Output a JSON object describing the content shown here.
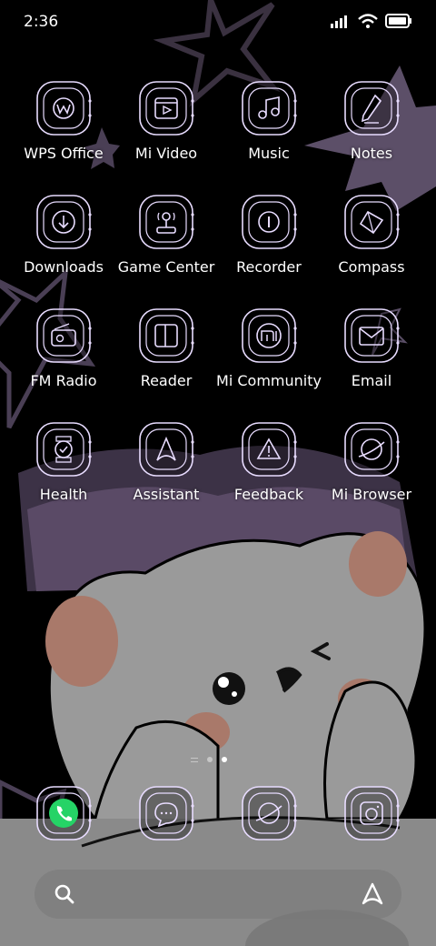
{
  "status_bar": {
    "time": "2:36",
    "icons": [
      "signal-icon",
      "wifi-icon",
      "battery-icon"
    ]
  },
  "theme": {
    "icon_stroke": "#e8dcff",
    "accent_purple": "#5a4a66",
    "bear_gray": "#9a9a9a",
    "whatsapp_green": "#25d366"
  },
  "apps": [
    {
      "label": "WPS Office",
      "icon": "wps-office-icon"
    },
    {
      "label": "Mi Video",
      "icon": "mi-video-icon"
    },
    {
      "label": "Music",
      "icon": "music-icon"
    },
    {
      "label": "Notes",
      "icon": "notes-icon"
    },
    {
      "label": "Downloads",
      "icon": "downloads-icon"
    },
    {
      "label": "Game Center",
      "icon": "game-center-icon"
    },
    {
      "label": "Recorder",
      "icon": "recorder-icon"
    },
    {
      "label": "Compass",
      "icon": "compass-icon"
    },
    {
      "label": "FM Radio",
      "icon": "fm-radio-icon"
    },
    {
      "label": "Reader",
      "icon": "reader-icon"
    },
    {
      "label": "Mi Community",
      "icon": "mi-community-icon"
    },
    {
      "label": "Email",
      "icon": "email-icon"
    },
    {
      "label": "Health",
      "icon": "health-icon"
    },
    {
      "label": "Assistant",
      "icon": "assistant-icon"
    },
    {
      "label": "Feedback",
      "icon": "feedback-icon"
    },
    {
      "label": "Mi Browser",
      "icon": "mi-browser-icon"
    }
  ],
  "page_indicator": {
    "pages": 3,
    "active_page": 3
  },
  "dock": [
    {
      "icon": "phone-icon"
    },
    {
      "icon": "messages-icon"
    },
    {
      "icon": "browser-icon"
    },
    {
      "icon": "camera-icon"
    }
  ],
  "search_bar": {
    "left_icon": "search-icon",
    "right_icon": "assistant-icon"
  }
}
